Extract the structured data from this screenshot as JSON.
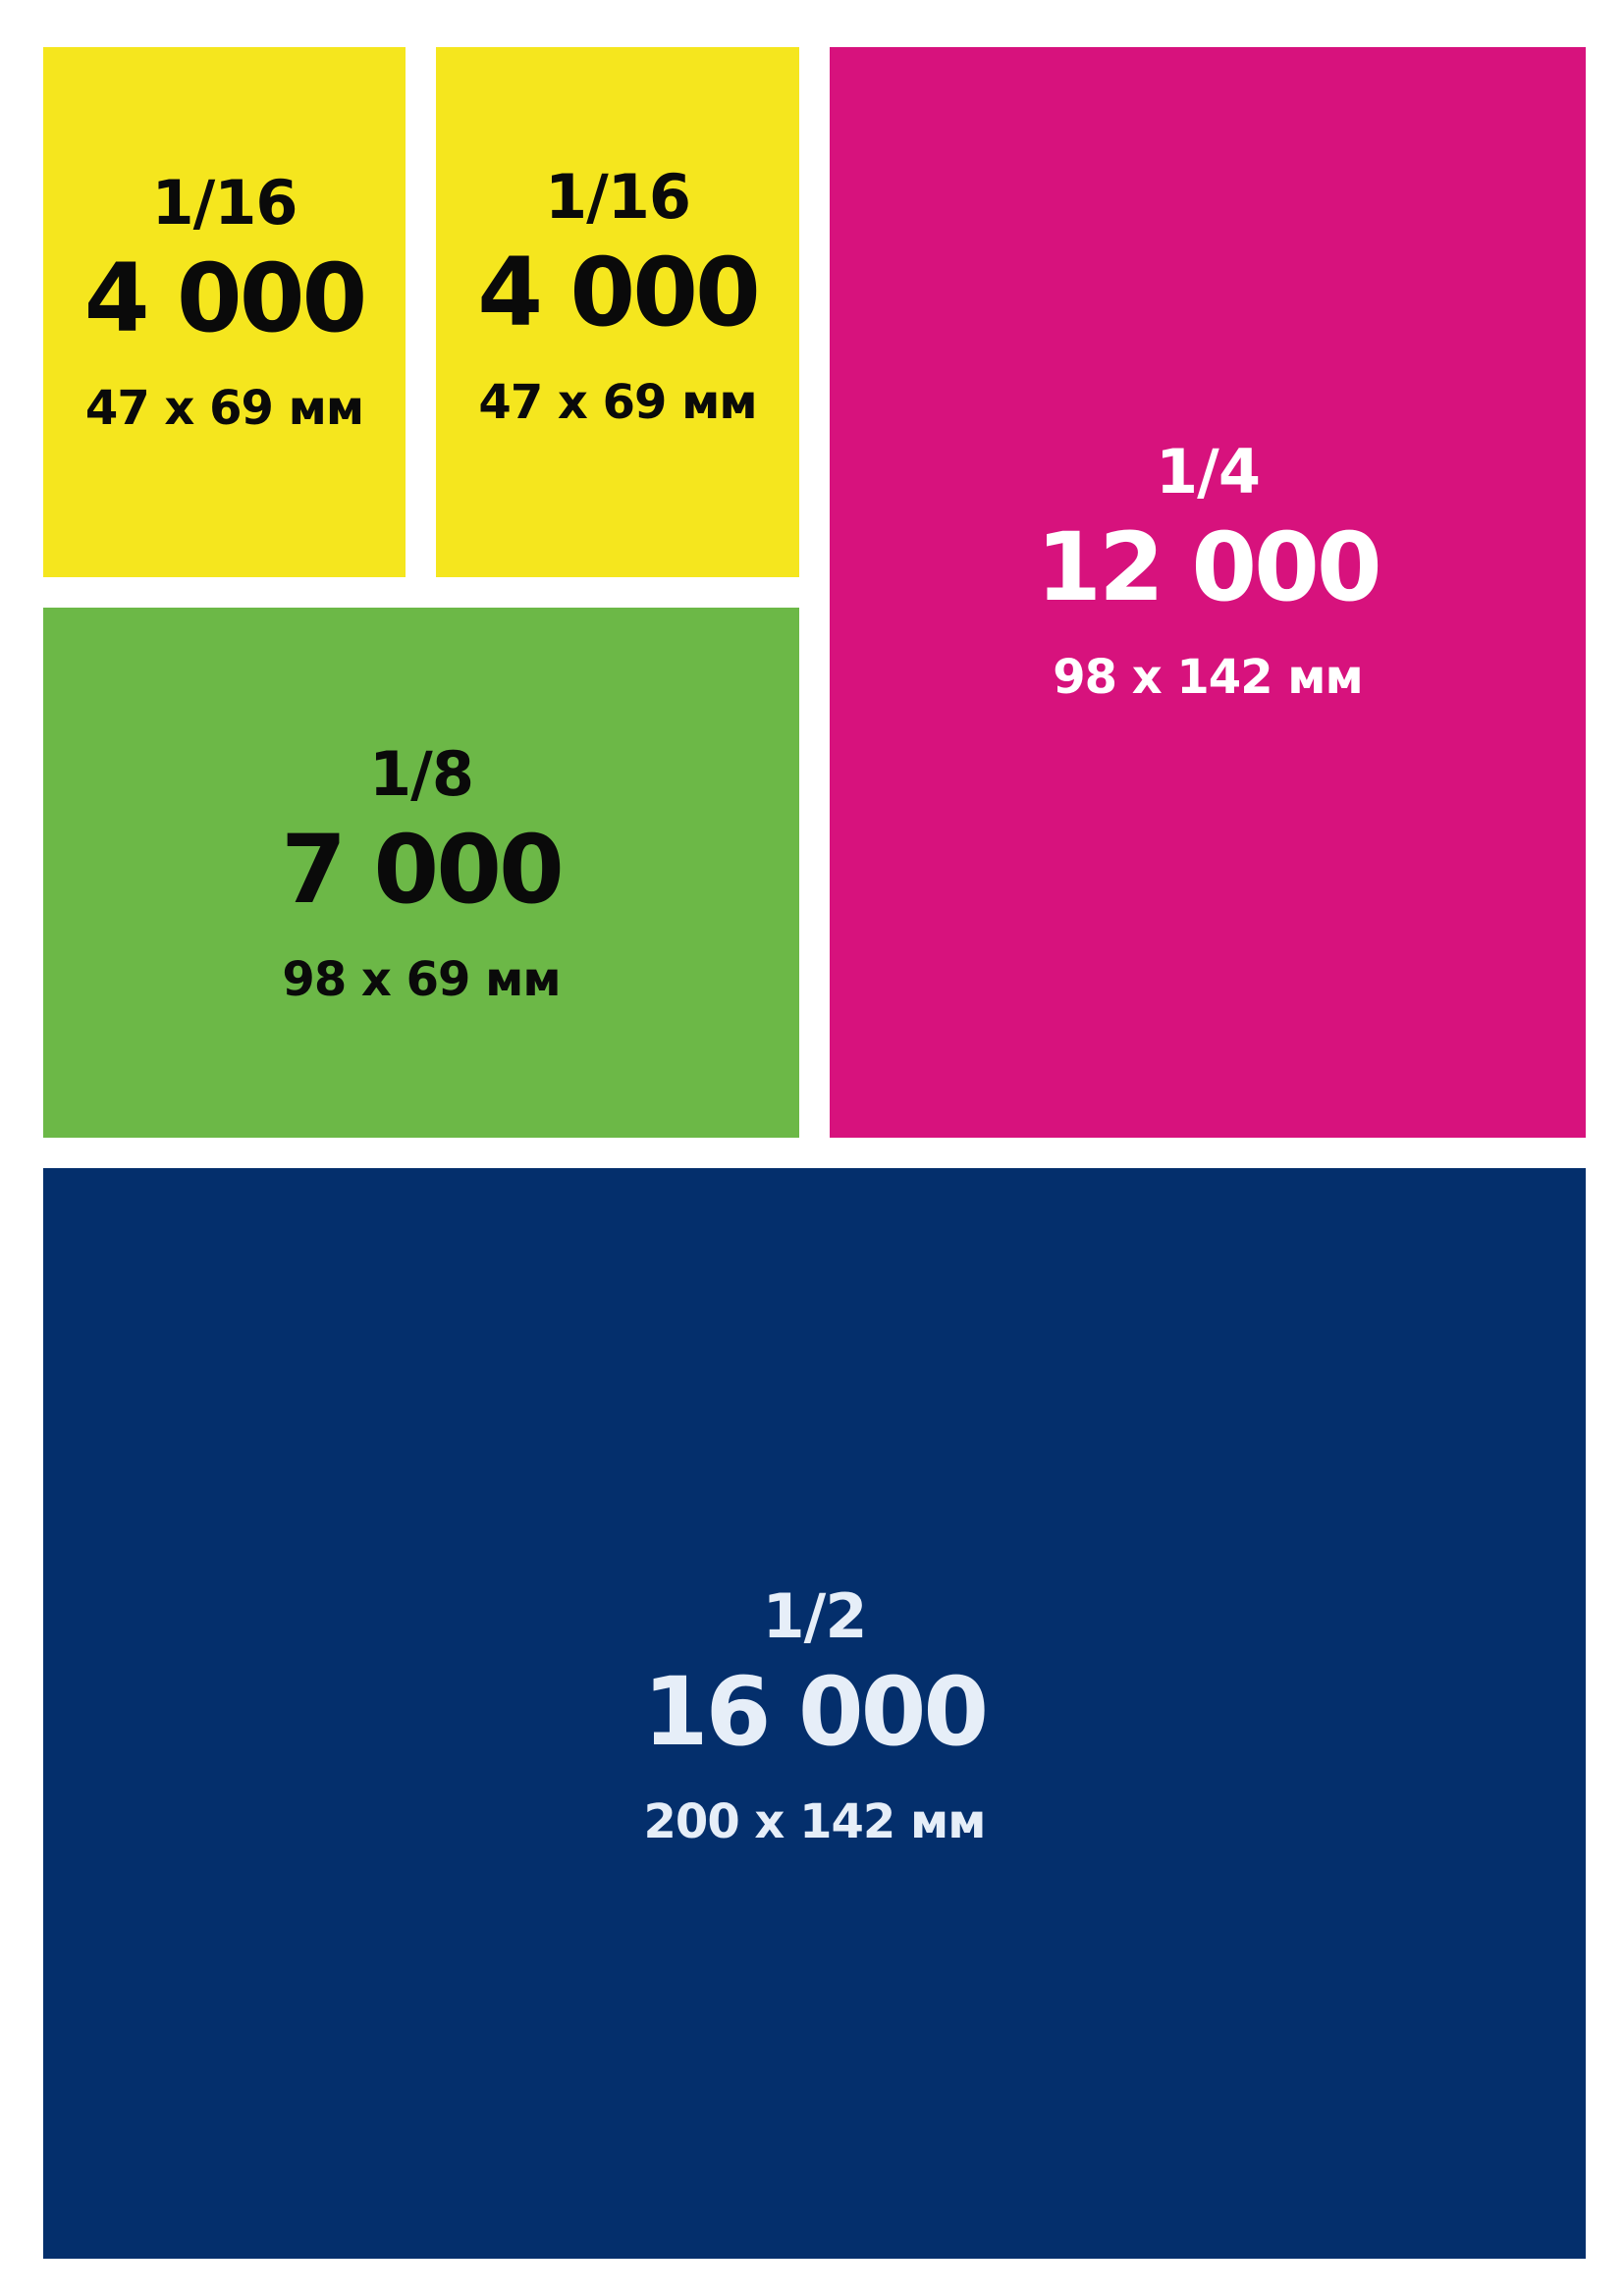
{
  "colors": {
    "yellow": "#f5e61e",
    "green": "#6cb847",
    "magenta": "#d7127d",
    "navy": "#042f6c",
    "dark_text": "#0a0a0a",
    "light_text": "#ffffff",
    "light_text_navy": "#e6eef8"
  },
  "blocks": [
    {
      "fraction": "1/16",
      "price": "4 000",
      "size": "47 x 69 мм"
    },
    {
      "fraction": "1/16",
      "price": "4 000",
      "size": "47 x 69 мм"
    },
    {
      "fraction": "1/8",
      "price": "7 000",
      "size": "98 x 69 мм"
    },
    {
      "fraction": "1/4",
      "price": "12 000",
      "size": "98 x 142 мм"
    },
    {
      "fraction": "1/2",
      "price": "16 000",
      "size": "200 x 142 мм"
    }
  ]
}
